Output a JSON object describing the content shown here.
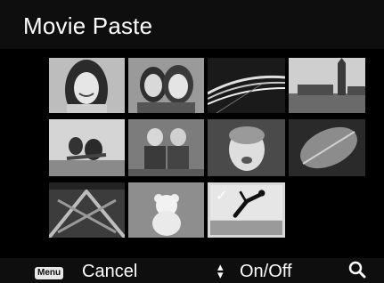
{
  "screen": {
    "title": "Movie Paste"
  },
  "thumbnails": [
    {
      "subject": "smiling woman portrait",
      "selected": false
    },
    {
      "subject": "couple portrait",
      "selected": false
    },
    {
      "subject": "highway light trails at night",
      "selected": false
    },
    {
      "subject": "city skyline with clock tower",
      "selected": false
    },
    {
      "subject": "family playing outdoors",
      "selected": false
    },
    {
      "subject": "two children sitting",
      "selected": false
    },
    {
      "subject": "crying toddler",
      "selected": false
    },
    {
      "subject": "leaf close-up",
      "selected": false
    },
    {
      "subject": "carnival ride structure",
      "selected": false
    },
    {
      "subject": "teddy bear",
      "selected": false
    },
    {
      "subject": "jumping person",
      "selected": true,
      "mark": "✓"
    }
  ],
  "footer": {
    "menu_key": "Menu",
    "cancel_label": "Cancel",
    "updown_icon": "up-down-arrows",
    "onoff_label": "On/Off",
    "zoom_icon": "magnifier"
  },
  "colors": {
    "background": "#000000",
    "bar": "#0e0e0e",
    "selection_border": "#d8d8d8"
  }
}
